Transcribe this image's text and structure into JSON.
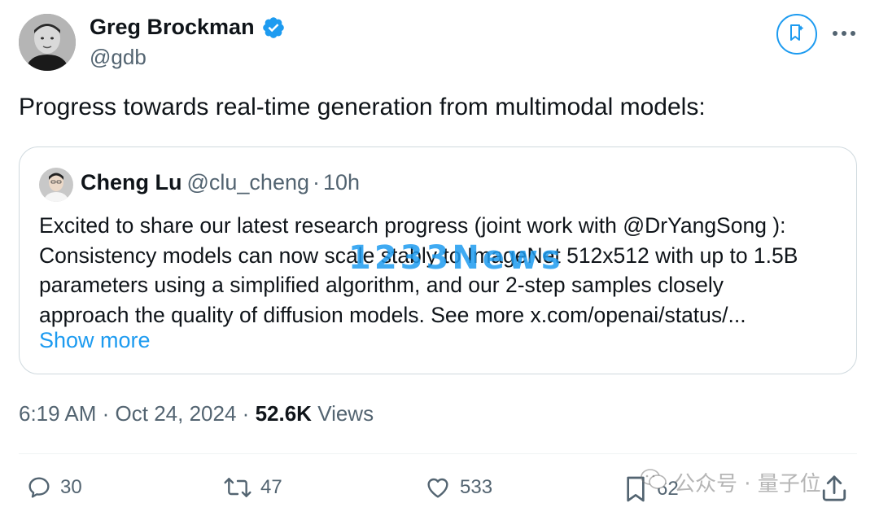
{
  "author": {
    "name": "Greg Brockman",
    "handle": "@gdb",
    "verified": true
  },
  "tweet": {
    "text": "Progress towards real-time generation from multimodal models:"
  },
  "quote": {
    "name": "Cheng Lu",
    "handle": "@clu_cheng",
    "separator": "·",
    "time": "10h",
    "lines": [
      "Excited to share our latest research progress (joint work with @DrYangSong ):",
      "Consistency models can now scale stably to ImageNet 512x512 with up to 1.5B",
      "parameters using a simplified algorithm, and our 2-step samples closely",
      "approach the quality of diffusion models. See more x.com/openai/status/..."
    ],
    "show_more": "Show more"
  },
  "meta": {
    "time": "6:19 AM",
    "sep1": "·",
    "date": "Oct 24, 2024",
    "sep2": "·",
    "views_count": "52.6K",
    "views_label": "Views"
  },
  "actions": {
    "replies": "30",
    "reposts": "47",
    "likes": "533",
    "bookmarks": "62"
  },
  "watermark": "1233News",
  "wechat_watermark": "公众号 · 量子位",
  "icons": {
    "verified": "verified-badge-icon",
    "grok": "grok-bookmark-icon",
    "more": "more-dots-icon",
    "reply": "reply-icon",
    "repost": "repost-icon",
    "like": "heart-icon",
    "bookmark": "bookmark-icon",
    "share": "share-icon"
  },
  "colors": {
    "accent": "#1d9bf0",
    "text": "#0f1419",
    "secondary": "#536471",
    "border": "#cfd9de"
  }
}
